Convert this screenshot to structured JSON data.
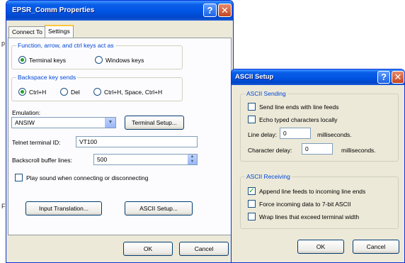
{
  "background_fragments": [
    "p",
    "F"
  ],
  "comm_window": {
    "title": "EPSR_Comm Properties",
    "help_glyph": "?",
    "close_glyph": "✕",
    "tabs": [
      {
        "label": "Connect To",
        "active": false
      },
      {
        "label": "Settings",
        "active": true
      }
    ],
    "keys_group": {
      "legend": "Function, arrow, and ctrl keys act as",
      "options": [
        {
          "label": "Terminal keys",
          "selected": true
        },
        {
          "label": "Windows keys",
          "selected": false
        }
      ]
    },
    "backspace_group": {
      "legend": "Backspace key sends",
      "options": [
        {
          "label": "Ctrl+H",
          "selected": true
        },
        {
          "label": "Del",
          "selected": false
        },
        {
          "label": "Ctrl+H, Space, Ctrl+H",
          "selected": false
        }
      ]
    },
    "emulation": {
      "label": "Emulation:",
      "value": "ANSIW",
      "setup_button": "Terminal Setup..."
    },
    "telnet": {
      "label": "Telnet terminal ID:",
      "value": "VT100"
    },
    "backscroll": {
      "label": "Backscroll buffer lines:",
      "value": "500"
    },
    "play_sound": {
      "label": "Play sound when connecting or disconnecting",
      "checked": false
    },
    "input_translation_button": "Input Translation...",
    "ascii_setup_button": "ASCII Setup...",
    "ok_button": "OK",
    "cancel_button": "Cancel"
  },
  "ascii_window": {
    "title": "ASCII Setup",
    "help_glyph": "?",
    "close_glyph": "✕",
    "sending": {
      "legend": "ASCII Sending",
      "send_line_ends": {
        "label": "Send line ends with line feeds",
        "checked": false
      },
      "echo": {
        "label": "Echo typed characters locally",
        "checked": false
      },
      "line_delay": {
        "label": "Line delay:",
        "value": "0",
        "unit": "milliseconds."
      },
      "char_delay": {
        "label": "Character delay:",
        "value": "0",
        "unit": "milliseconds."
      }
    },
    "receiving": {
      "legend": "ASCII Receiving",
      "append": {
        "label": "Append line feeds to incoming line ends",
        "checked": true
      },
      "force7": {
        "label": "Force incoming data to 7-bit ASCII",
        "checked": false
      },
      "wrap": {
        "label": "Wrap lines that exceed terminal width",
        "checked": false
      }
    },
    "ok_button": "OK",
    "cancel_button": "Cancel"
  },
  "colors": {
    "titlebar": "#0054e3",
    "window_face": "#ece9d8",
    "group_legend": "#0046d5",
    "check_green": "#21a121"
  }
}
